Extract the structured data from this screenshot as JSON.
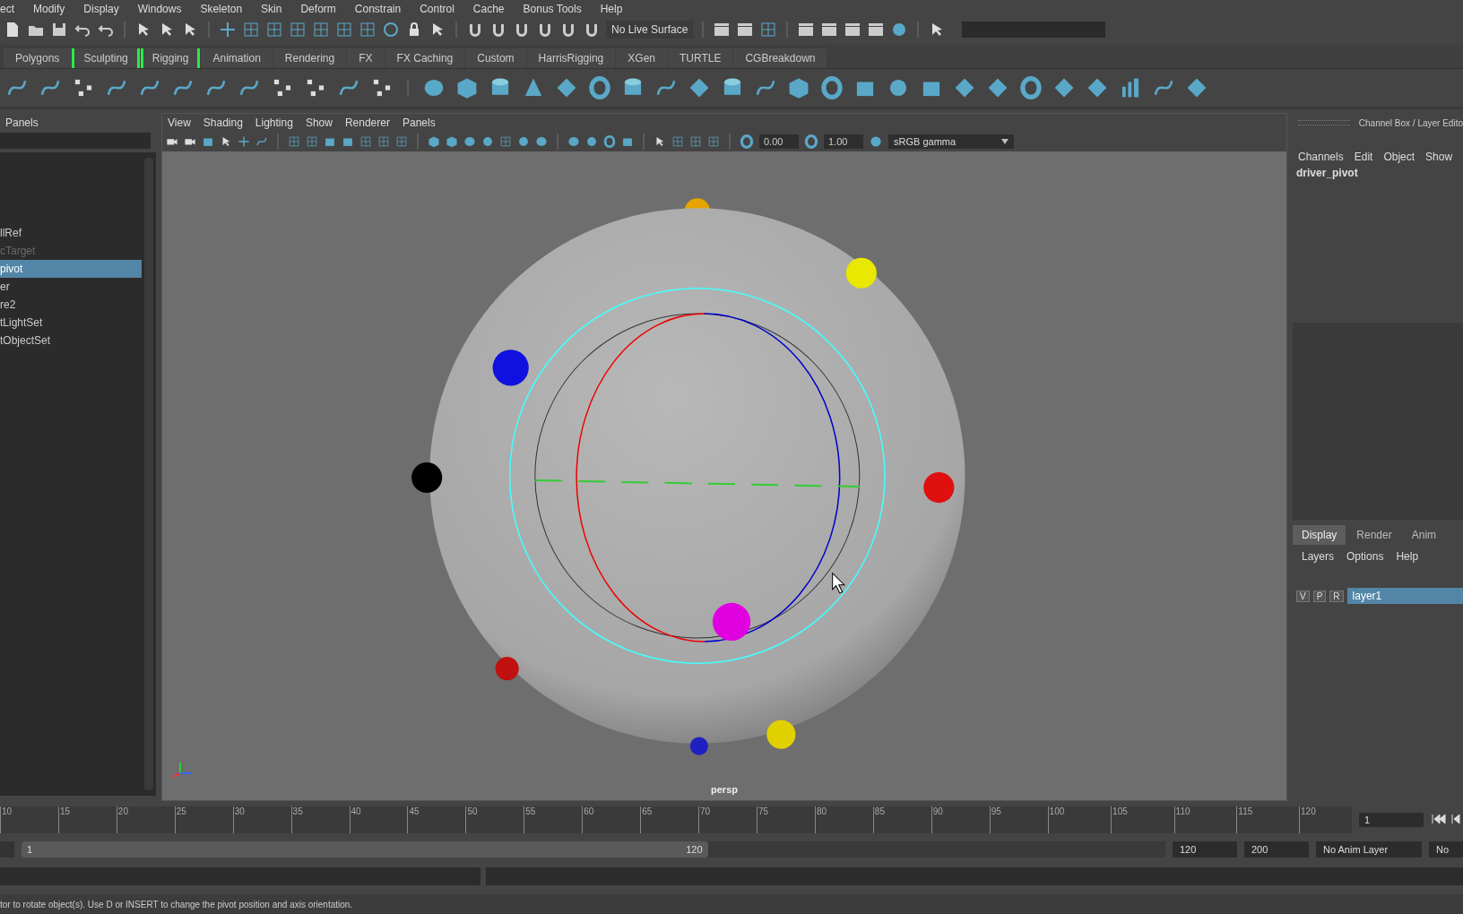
{
  "menu_bar": [
    "ect",
    "Modify",
    "Display",
    "Windows",
    "Skeleton",
    "Skin",
    "Deform",
    "Constrain",
    "Control",
    "Cache",
    "Bonus Tools",
    "Help"
  ],
  "status_line": {
    "live_surface": "No Live Surface"
  },
  "shelf_tabs": [
    {
      "label": "Polygons",
      "highlighted": false
    },
    {
      "label": "Sculpting",
      "highlighted": true
    },
    {
      "label": "Rigging",
      "highlighted": true
    },
    {
      "label": "Animation",
      "highlighted": false
    },
    {
      "label": "Rendering",
      "highlighted": false
    },
    {
      "label": "FX",
      "highlighted": false
    },
    {
      "label": "FX Caching",
      "highlighted": false
    },
    {
      "label": "Custom",
      "highlighted": false
    },
    {
      "label": "HarrisRigging",
      "highlighted": false
    },
    {
      "label": "XGen",
      "highlighted": false
    },
    {
      "label": "TURTLE",
      "highlighted": false
    },
    {
      "label": "CGBreakdown",
      "highlighted": false
    }
  ],
  "outliner": {
    "header": "Panels",
    "items": [
      {
        "label": "llRef",
        "selected": false,
        "dimmed": false
      },
      {
        "label": "cTarget",
        "selected": false,
        "dimmed": true
      },
      {
        "label": "pivot",
        "selected": true,
        "dimmed": false
      },
      {
        "label": "er",
        "selected": false,
        "dimmed": false
      },
      {
        "label": "re2",
        "selected": false,
        "dimmed": false
      },
      {
        "label": "tLightSet",
        "selected": false,
        "dimmed": false
      },
      {
        "label": "tObjectSet",
        "selected": false,
        "dimmed": false
      }
    ]
  },
  "viewport": {
    "menus": [
      "View",
      "Shading",
      "Lighting",
      "Show",
      "Renderer",
      "Panels"
    ],
    "exposure": "0.00",
    "gamma": "1.00",
    "color_space": "sRGB gamma",
    "camera_label": "persp"
  },
  "channel_box": {
    "title": "Channel Box / Layer Edito",
    "menus": [
      "Channels",
      "Edit",
      "Object",
      "Show"
    ],
    "object": "driver_pivot"
  },
  "layer_editor": {
    "tabs": [
      {
        "label": "Display",
        "selected": true
      },
      {
        "label": "Render",
        "selected": false
      },
      {
        "label": "Anim",
        "selected": false
      }
    ],
    "menus": [
      "Layers",
      "Options",
      "Help"
    ],
    "layers": [
      {
        "buttons": [
          "V",
          "P",
          "R"
        ],
        "name": "layer1",
        "selected": true
      }
    ]
  },
  "time_slider": {
    "ticks": [
      "10",
      "15",
      "20",
      "25",
      "30",
      "35",
      "40",
      "45",
      "50",
      "55",
      "60",
      "65",
      "70",
      "75",
      "80",
      "85",
      "90",
      "95",
      "100",
      "105",
      "110",
      "115",
      "120"
    ],
    "current_frame": "1"
  },
  "range_slider": {
    "level": 0.6,
    "range_start": "1",
    "range_end": "120",
    "end": "120",
    "max": "200",
    "anim_layer": "No Anim Layer",
    "character": "No"
  },
  "help_line": "tor to rotate object(s). Use D or INSERT to change the pivot position and axis orientation."
}
